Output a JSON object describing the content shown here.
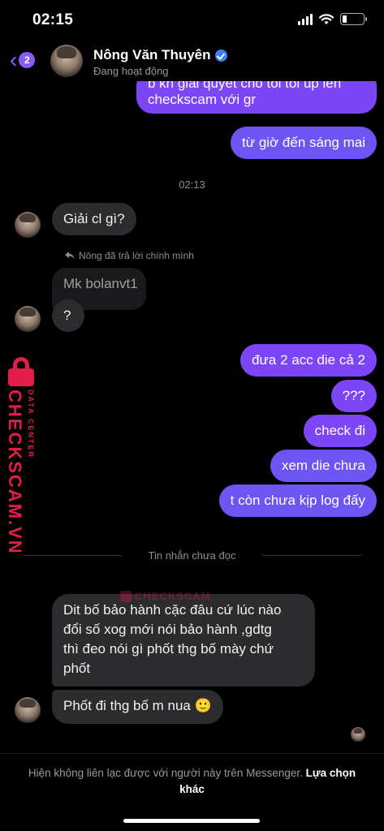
{
  "status_bar": {
    "time": "02:15",
    "battery_level": 0.2
  },
  "header": {
    "back_count": "2",
    "name": "Nông Văn Thuyên",
    "status": "Đang hoạt động"
  },
  "messages": {
    "out_partial_line1": "b kh giải quyết cho tôi tôi úp lên",
    "out_partial_line2": "checkscam với gr",
    "out_1": "từ giờ đến sáng mai",
    "time_1": "02:13",
    "in_1": "Giải cl gì?",
    "reply_note": "Nông đã trả lời chính mình",
    "reply_quote": "Mk bolanvt1",
    "in_2": "?",
    "out_2": "đưa 2 acc die cả 2",
    "out_3": "???",
    "out_4": "check đi",
    "out_5": "xem die chưa",
    "out_6": "t còn chưa kịp log đấy",
    "unread_divider": "Tin nhắn chưa đọc",
    "in_3_line1": "Dit bố bảo hành cặc đâu cứ lúc nào",
    "in_3_line2": "đổi số xog mới nói bảo hành ,gdtg",
    "in_3_line3": "thì đeo nói gì phốt thg bố mày chứ",
    "in_3_line4": "phốt",
    "in_4": "Phốt đi thg bố m nua 🙂"
  },
  "watermark": {
    "brand": "CHECKSCAM.VN",
    "sub": "DATA CENTER",
    "center": "CHECKSCAM"
  },
  "footer": {
    "notice": "Hiện không liên lạc được với người này trên Messenger.",
    "link": "Lựa chọn khác"
  },
  "colors": {
    "outgoing_bubble": "#7c45f5",
    "incoming_bubble": "#2c2c2e",
    "accent": "#8a5cf6",
    "watermark": "#e11d48"
  },
  "icons": [
    "signal-icon",
    "wifi-icon",
    "battery-icon",
    "back-chevron-icon",
    "verified-icon",
    "reply-arrow-icon",
    "lock-icon",
    "emoji-smile-icon"
  ]
}
